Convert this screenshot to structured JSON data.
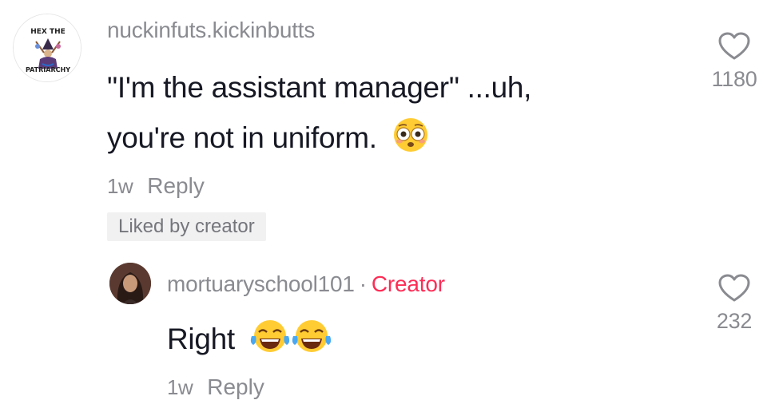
{
  "comment1": {
    "username": "nuckinfuts.kickinbutts",
    "text_line1": "\"I'm the assistant manager\" ...uh,",
    "text_line2": "you're not in uniform.",
    "avatar_text_top": "HEX THE",
    "avatar_text_bottom": "PATRIARCHY",
    "time": "1w",
    "reply_label": "Reply",
    "liked_badge": "Liked by creator",
    "like_count": "1180",
    "emoji_icon": "flushed-face-icon"
  },
  "comment2": {
    "username": "mortuaryschool101",
    "separator": "·",
    "creator_label": "Creator",
    "text": "Right",
    "time": "1w",
    "reply_label": "Reply",
    "like_count": "232",
    "emoji_icon": "tears-of-joy-icon"
  },
  "colors": {
    "text": "#161823",
    "muted": "#8a8b91",
    "creator": "#fe2c55",
    "badge_bg": "#f1f1f2"
  }
}
